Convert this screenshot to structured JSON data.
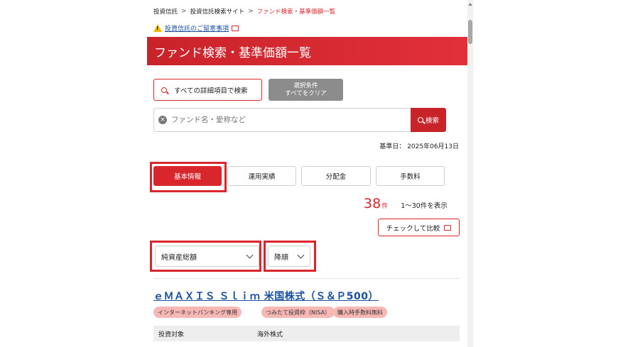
{
  "breadcrumb": {
    "items": [
      "投資信託",
      "投資信託検索サイト"
    ],
    "current": "ファンド検索・基準価額一覧",
    "separator": ">"
  },
  "notice": {
    "link_label": "投資信託のご留意事項"
  },
  "page_title": "ファンド検索・基準価額一覧",
  "buttons": {
    "detail_search": "すべての詳細項目で検索",
    "clear_line1": "選択条件",
    "clear_line2": "すべてをクリア",
    "search": "検索",
    "compare": "チェックして比較"
  },
  "search": {
    "placeholder": "ファンド名・愛称など",
    "clear_glyph": "×"
  },
  "base_date": "基準日： 2025年06月13日",
  "tabs": [
    {
      "label": "基本情報",
      "active": true
    },
    {
      "label": "運用実績",
      "active": false
    },
    {
      "label": "分配金",
      "active": false
    },
    {
      "label": "手数料",
      "active": false
    }
  ],
  "results": {
    "count": "38",
    "unit": "件",
    "range": "1〜30件を表示"
  },
  "sort": {
    "field": "純資産総額",
    "order": "降順"
  },
  "fund": {
    "name": "ｅＭＡＸＩＳ Ｓｌｉｍ 米国株式（Ｓ＆Ｐ500）",
    "tags": [
      "インターネットバンキング専用",
      "つみたて投資枠（NISA）",
      "購入時手数料無料"
    ],
    "rows": [
      {
        "label": "投資対象",
        "value": "海外株式"
      }
    ]
  },
  "colors": {
    "accent": "#d9262c",
    "link": "#1a4fa0",
    "tag_bg": "#f6b7b5",
    "clear_btn": "#8c8c8c"
  }
}
